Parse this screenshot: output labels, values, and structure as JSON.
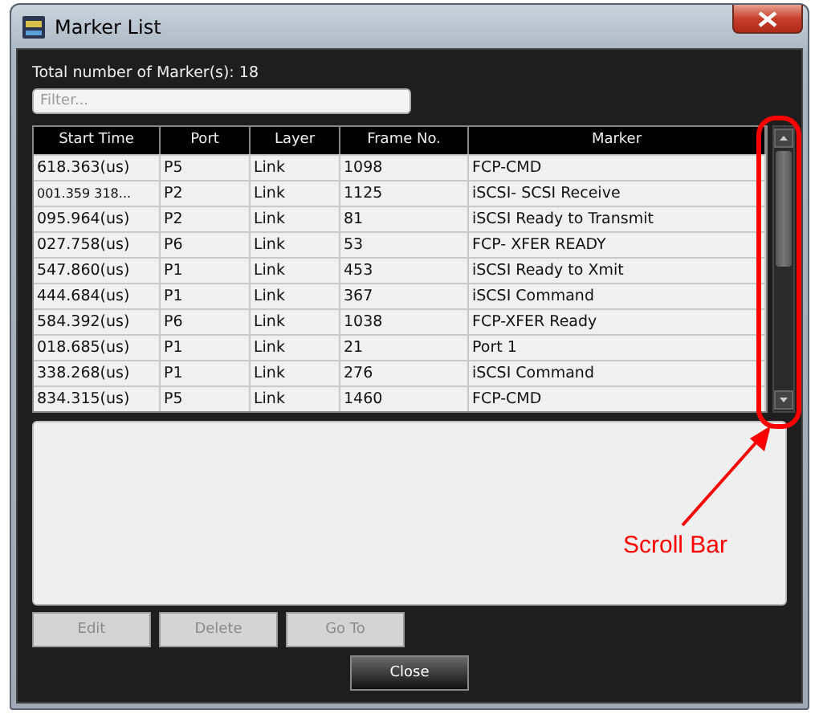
{
  "window": {
    "title": "Marker List"
  },
  "summary": "Total number of Marker(s): 18",
  "filter": {
    "placeholder": "Filter..."
  },
  "table": {
    "columns": [
      "Start Time",
      "Port",
      "Layer",
      "Frame No.",
      "Marker"
    ],
    "rows": [
      [
        "618.363(us)",
        "P5",
        "Link",
        "1098",
        "FCP-CMD"
      ],
      [
        "001.359 318...",
        "P2",
        "Link",
        "1125",
        "iSCSI- SCSI Receive"
      ],
      [
        "095.964(us)",
        "P2",
        "Link",
        "81",
        "iSCSI Ready to Transmit"
      ],
      [
        "027.758(us)",
        "P6",
        "Link",
        "53",
        "FCP- XFER READY"
      ],
      [
        "547.860(us)",
        "P1",
        "Link",
        "453",
        "iSCSI Ready to Xmit"
      ],
      [
        "444.684(us)",
        "P1",
        "Link",
        "367",
        "iSCSI Command"
      ],
      [
        "584.392(us)",
        "P6",
        "Link",
        "1038",
        "FCP-XFER Ready"
      ],
      [
        "018.685(us)",
        "P1",
        "Link",
        "21",
        "Port 1"
      ],
      [
        "338.268(us)",
        "P1",
        "Link",
        "276",
        "iSCSI Command"
      ],
      [
        "834.315(us)",
        "P5",
        "Link",
        "1460",
        "FCP-CMD"
      ]
    ]
  },
  "buttons": [
    {
      "label": "Edit",
      "disabled": true
    },
    {
      "label": "Delete",
      "disabled": true
    },
    {
      "label": "Go To",
      "disabled": true
    }
  ],
  "close_button": {
    "label": "Close",
    "disabled": false
  },
  "annotation": {
    "label": "Scroll Bar"
  }
}
